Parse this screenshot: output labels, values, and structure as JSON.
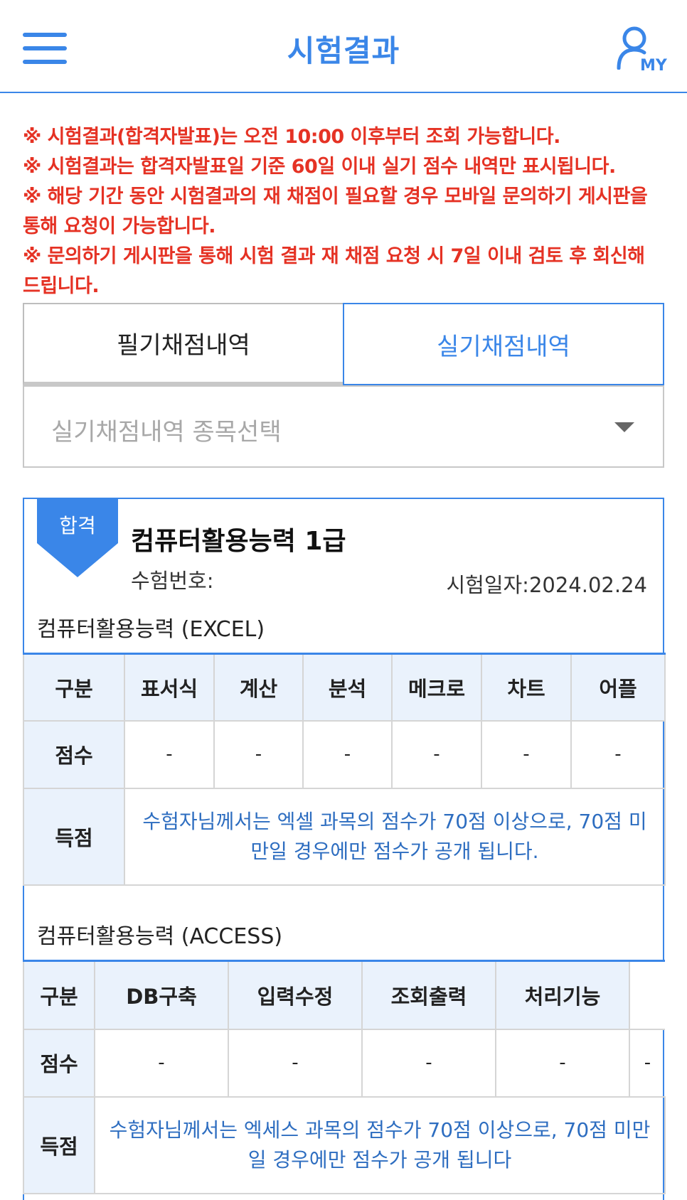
{
  "header": {
    "title": "시험결과",
    "my_label": "MY",
    "menu_icon": "hamburger-icon",
    "profile_icon": "user-icon",
    "accent_color": "#3a86e8"
  },
  "notices": [
    "※ 시험결과(합격자발표)는 오전 10:00 이후부터 조회 가능합니다.",
    "※ 시험결과는 합격자발표일 기준 60일 이내 실기 점수 내역만 표시됩니다.",
    "※ 해당 기간 동안 시험결과의 재 채점이 필요할 경우 모바일 문의하기 게시판을 통해 요청이 가능합니다.",
    "※ 문의하기 게시판을 통해 시험 결과 재 채점 요청 시 7일 이내 검토 후 회신해 드립니다."
  ],
  "notice_color": "#e53224",
  "tabs": {
    "written": "필기채점내역",
    "practical": "실기채점내역",
    "active": "practical"
  },
  "select": {
    "placeholder": "실기채점내역 종목선택",
    "caret_icon": "chevron-down-icon"
  },
  "result": {
    "badge": "합격",
    "exam_name": "컴퓨터활용능력 1급",
    "exam_no_label": "수험번호:",
    "exam_date_label": "시험일자:",
    "exam_date": "2024.02.24",
    "excel": {
      "title": "컴퓨터활용능력 (EXCEL)",
      "header": [
        "구분",
        "표서식",
        "계산",
        "분석",
        "메크로",
        "차트",
        "어플"
      ],
      "score_label": "점수",
      "scores": [
        "-",
        "-",
        "-",
        "-",
        "-",
        "-"
      ],
      "points_label": "득점",
      "note": "수험자님께서는 엑셀 과목의 점수가 70점 이상으로, 70점 미만일 경우에만 점수가 공개 됩니다."
    },
    "access": {
      "title": "컴퓨터활용능력 (ACCESS)",
      "header": [
        "구분",
        "DB구축",
        "입력수정",
        "조회출력",
        "처리기능"
      ],
      "score_label": "점수",
      "scores": [
        "-",
        "-",
        "-",
        "-",
        "-"
      ],
      "points_label": "득점",
      "note": "수험자님께서는 엑세스 과목의 점수가 70점 이상으로, 70점 미만일 경우에만 점수가 공개 됩니다"
    }
  }
}
